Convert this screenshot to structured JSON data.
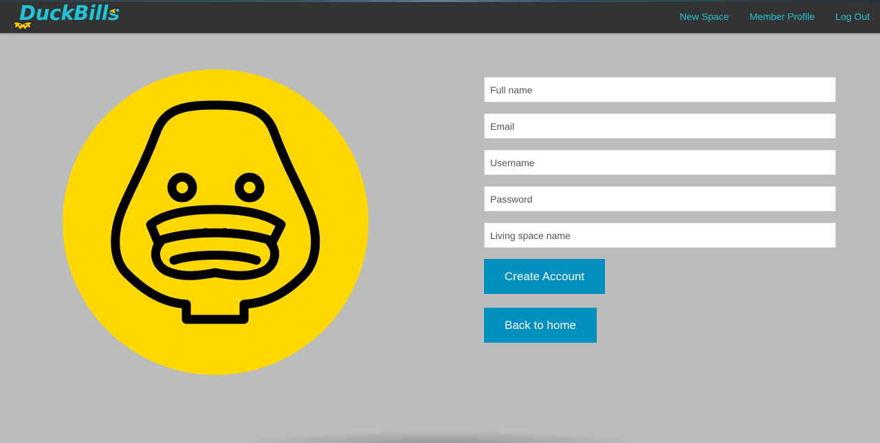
{
  "brand": {
    "name": "DuckBills",
    "color": "#21c4d6",
    "accent_color": "#f5c400"
  },
  "nav": {
    "links": [
      {
        "label": "New Space"
      },
      {
        "label": "Member Profile"
      },
      {
        "label": "Log Out"
      }
    ]
  },
  "hero": {
    "logo_icon": "duck-face-icon",
    "circle_color": "#ffd800",
    "stroke_color": "#000000"
  },
  "form": {
    "fields": [
      {
        "name": "full_name",
        "placeholder": "Full name"
      },
      {
        "name": "email",
        "placeholder": "Email"
      },
      {
        "name": "username",
        "placeholder": "Username"
      },
      {
        "name": "password",
        "placeholder": "Password"
      },
      {
        "name": "living_space_name",
        "placeholder": "Living space name"
      }
    ],
    "create_label": "Create Account",
    "back_label": "Back to home",
    "button_color": "#008fbe"
  },
  "colors": {
    "navbar": "#333333",
    "background": "#bbbdbb",
    "link": "#21c4d6"
  }
}
